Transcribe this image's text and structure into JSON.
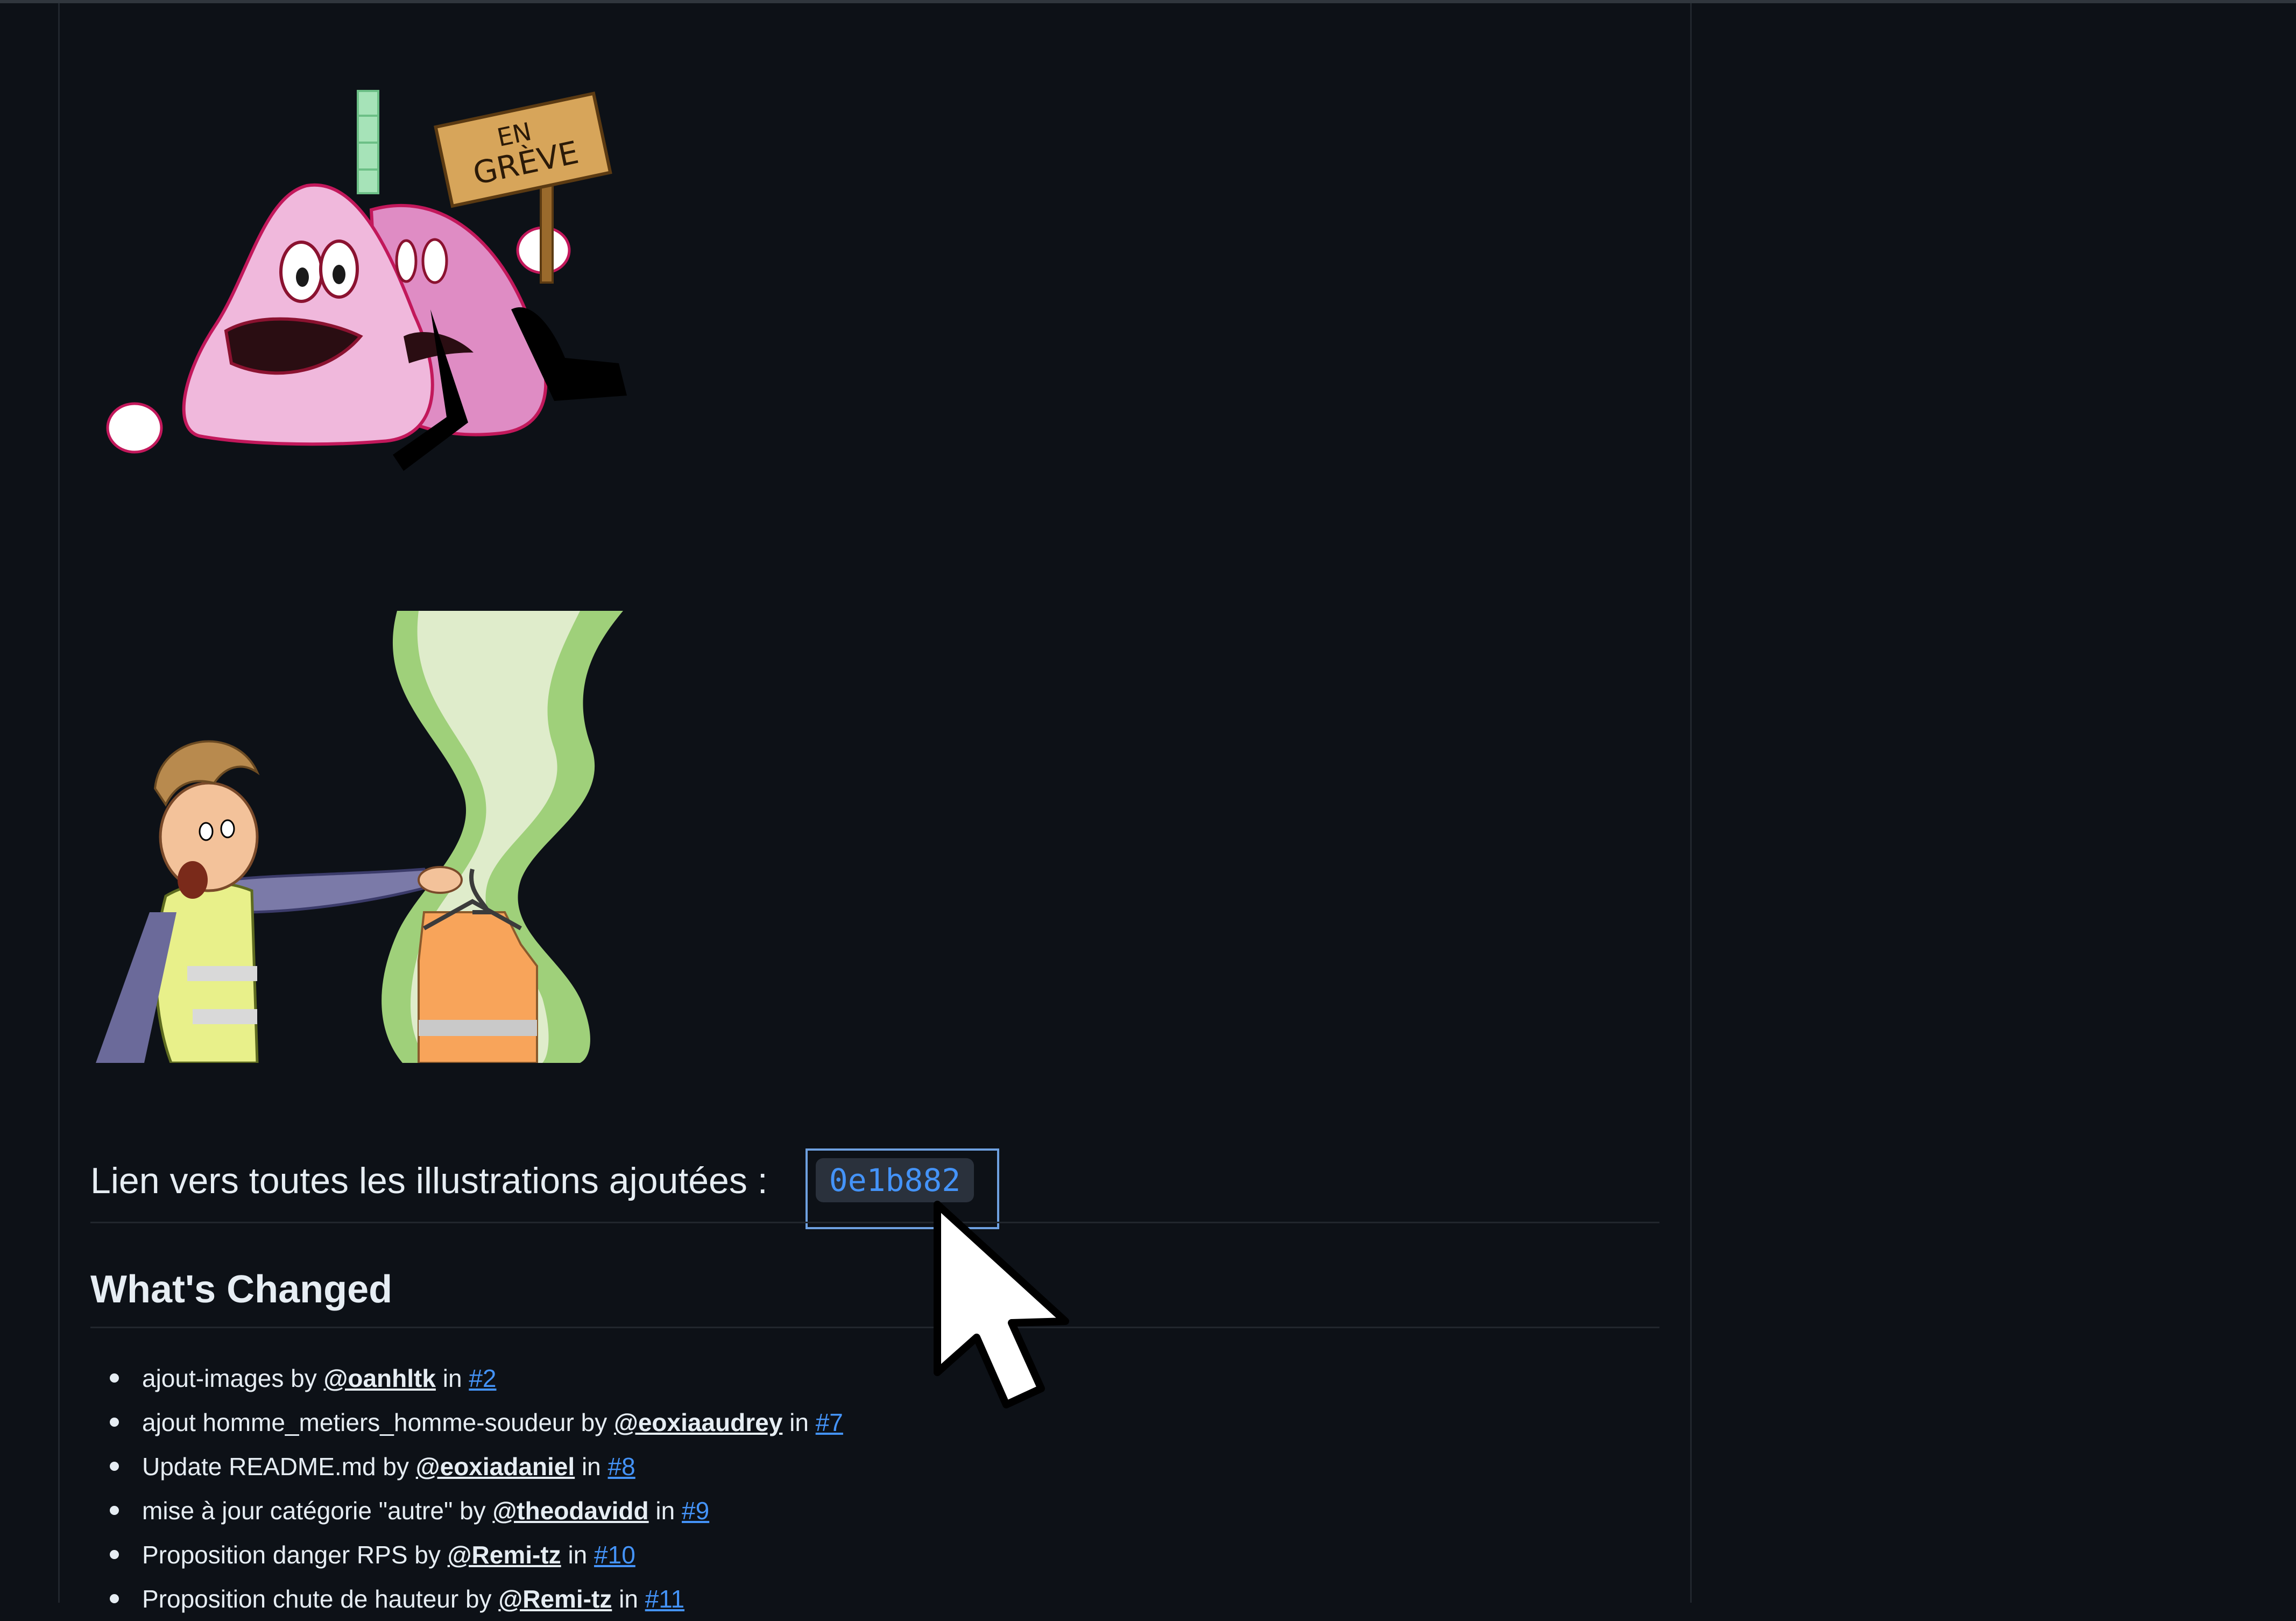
{
  "section": {
    "heading_prefix": "Lien vers toutes les illustrations ajoutées :",
    "commit_hash": "0e1b882",
    "changes_heading": "What's Changed"
  },
  "illustrations": [
    {
      "name": "lungs-strike",
      "sign_line1": "EN",
      "sign_line2": "GRÈVE"
    },
    {
      "name": "worker-vest"
    }
  ],
  "changes": [
    {
      "text": "ajout-images",
      "by": "by",
      "user": "@oanhltk",
      "in": "in",
      "pr": "#2"
    },
    {
      "text": "ajout homme_metiers_homme-soudeur",
      "by": "by",
      "user": "@eoxiaaudrey",
      "in": "in",
      "pr": "#7"
    },
    {
      "text": "Update README.md",
      "by": "by",
      "user": "@eoxiadaniel",
      "in": "in",
      "pr": "#8"
    },
    {
      "text": "mise à jour catégorie \"autre\"",
      "by": "by",
      "user": "@theodavidd",
      "in": "in",
      "pr": "#9"
    },
    {
      "text": "Proposition danger RPS",
      "by": "by",
      "user": "@Remi-tz",
      "in": "in",
      "pr": "#10"
    },
    {
      "text": "Proposition chute de hauteur",
      "by": "by",
      "user": "@Remi-tz",
      "in": "in",
      "pr": "#11"
    }
  ],
  "colors": {
    "background": "#0d1117",
    "text": "#e6edf3",
    "link": "#4493f8",
    "focus": "#6ea0e0"
  }
}
